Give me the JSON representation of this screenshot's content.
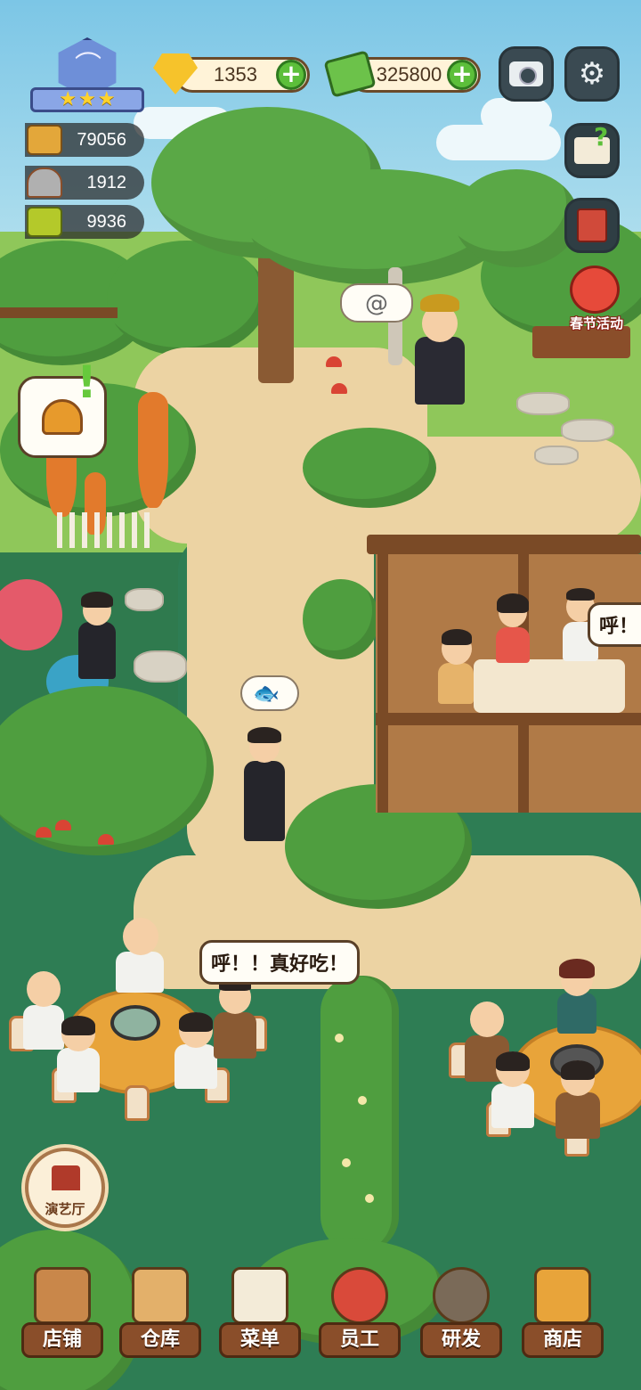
{
  "hud": {
    "rank": {
      "stars": [
        "★",
        "★",
        "★"
      ]
    },
    "currencies": {
      "gems": {
        "value": "1353",
        "add_label": "+",
        "icon": "gold-gem-icon"
      },
      "cash": {
        "value": "325800",
        "add_label": "+",
        "icon": "cash-bundle-icon"
      }
    },
    "top_right": {
      "camera_icon": "camera-icon",
      "settings_glyph": "⚙",
      "help_glyph": "?",
      "recipe_book_icon": "red-book-icon"
    },
    "stats": [
      {
        "icon": "pot-icon",
        "value": "79056"
      },
      {
        "icon": "serving-dish-icon",
        "value": "1912"
      },
      {
        "icon": "menu-book-icon",
        "value": "9936"
      }
    ],
    "event": {
      "label": "春节活动",
      "icon": "lion-dance-icon"
    },
    "theater": {
      "label": "演艺厅",
      "icon": "theater-icon"
    }
  },
  "bubbles": {
    "speech_main": "呼！！真好吃！",
    "speech_pavilion": "呼！",
    "bell_icon": "bell-icon",
    "fish_thought_icon": "fish-icon",
    "spiral_thought_icon": "spiral-icon"
  },
  "bottom_nav": [
    {
      "label": "店铺",
      "icon": "shop-building-icon"
    },
    {
      "label": "仓库",
      "icon": "warehouse-boxes-icon"
    },
    {
      "label": "菜单",
      "icon": "menu-clipboard-icon"
    },
    {
      "label": "员工",
      "icon": "staff-chef-icon"
    },
    {
      "label": "研发",
      "icon": "wok-research-icon"
    },
    {
      "label": "商店",
      "icon": "store-stall-icon"
    }
  ],
  "colors": {
    "nav_label_bg": "#8a4e2a",
    "plus_green": "#5cbf3a",
    "lawn": "#2e7d54",
    "path": "#ecd3a3"
  }
}
